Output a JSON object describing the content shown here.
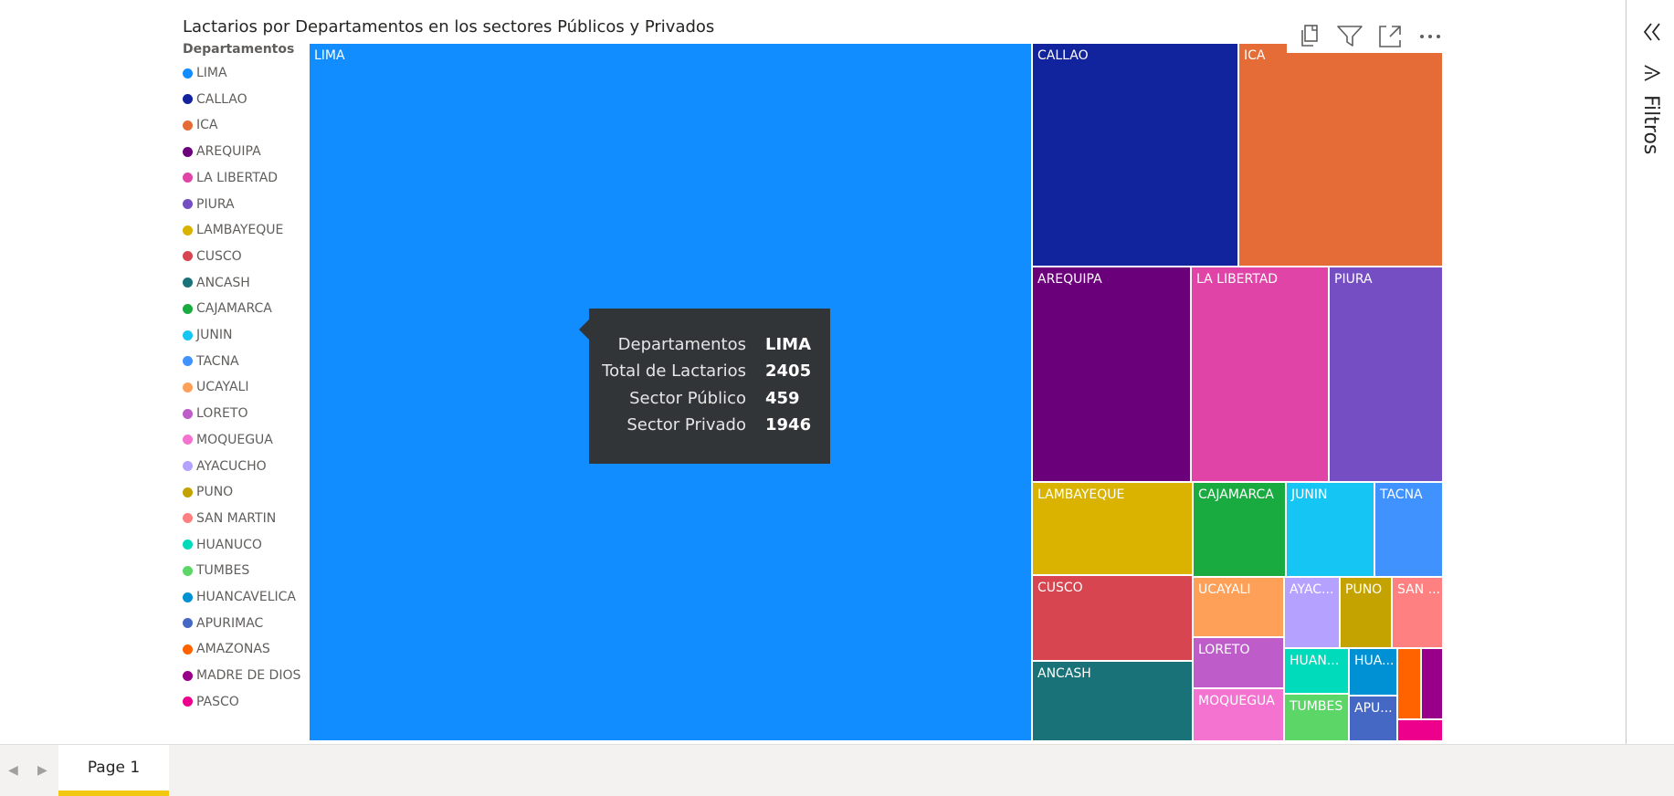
{
  "chart_data": {
    "type": "treemap",
    "title": "Lactarios por Departamentos en los sectores Públicos y Privados",
    "legend_title": "Departamentos",
    "legend_position": "left",
    "legend": [
      {
        "name": "LIMA",
        "color": "#118DFF"
      },
      {
        "name": "CALLAO",
        "color": "#12239E"
      },
      {
        "name": "ICA",
        "color": "#E66C37"
      },
      {
        "name": "AREQUIPA",
        "color": "#6B007B"
      },
      {
        "name": "LA LIBERTAD",
        "color": "#E044A7"
      },
      {
        "name": "PIURA",
        "color": "#744EC2"
      },
      {
        "name": "LAMBAYEQUE",
        "color": "#D9B300"
      },
      {
        "name": "CUSCO",
        "color": "#D64550"
      },
      {
        "name": "ANCASH",
        "color": "#197278"
      },
      {
        "name": "CAJAMARCA",
        "color": "#1AAB40"
      },
      {
        "name": "JUNIN",
        "color": "#15C6F4"
      },
      {
        "name": "TACNA",
        "color": "#4092FF"
      },
      {
        "name": "UCAYALI",
        "color": "#FFA058"
      },
      {
        "name": "LORETO",
        "color": "#BE5DC9"
      },
      {
        "name": "MOQUEGUA",
        "color": "#F472D0"
      },
      {
        "name": "AYACUCHO",
        "color": "#B5A1FF"
      },
      {
        "name": "PUNO",
        "color": "#C4A200"
      },
      {
        "name": "SAN MARTIN",
        "color": "#FF8080"
      },
      {
        "name": "HUANUCO",
        "color": "#00DBBC"
      },
      {
        "name": "TUMBES",
        "color": "#5BD667"
      },
      {
        "name": "HUANCAVELICA",
        "color": "#0091D5"
      },
      {
        "name": "APURIMAC",
        "color": "#4668C5"
      },
      {
        "name": "AMAZONAS",
        "color": "#FF6300"
      },
      {
        "name": "MADRE DE DIOS",
        "color": "#99008A"
      },
      {
        "name": "PASCO",
        "color": "#EC008C"
      }
    ],
    "tiles": [
      {
        "name": "LIMA",
        "label": "LIMA"
      },
      {
        "name": "CALLAO",
        "label": "CALLAO"
      },
      {
        "name": "ICA",
        "label": "ICA"
      },
      {
        "name": "AREQUIPA",
        "label": "AREQUIPA"
      },
      {
        "name": "LA LIBERTAD",
        "label": "LA LIBERTAD"
      },
      {
        "name": "PIURA",
        "label": "PIURA"
      },
      {
        "name": "LAMBAYEQUE",
        "label": "LAMBAYEQUE"
      },
      {
        "name": "CAJAMARCA",
        "label": "CAJAMARCA"
      },
      {
        "name": "JUNIN",
        "label": "JUNIN"
      },
      {
        "name": "TACNA",
        "label": "TACNA"
      },
      {
        "name": "CUSCO",
        "label": "CUSCO"
      },
      {
        "name": "UCAYALI",
        "label": "UCAYALI"
      },
      {
        "name": "AYACUCHO",
        "label": "AYAC..."
      },
      {
        "name": "PUNO",
        "label": "PUNO"
      },
      {
        "name": "SAN MARTIN",
        "label": "SAN ..."
      },
      {
        "name": "LORETO",
        "label": "LORETO"
      },
      {
        "name": "HUANUCO",
        "label": "HUAN..."
      },
      {
        "name": "HUANCAVELICA",
        "label": "HUA..."
      },
      {
        "name": "AMAZONAS",
        "label": ""
      },
      {
        "name": "MADRE DE DIOS",
        "label": ""
      },
      {
        "name": "ANCASH",
        "label": "ANCASH"
      },
      {
        "name": "MOQUEGUA",
        "label": "MOQUEGUA"
      },
      {
        "name": "TUMBES",
        "label": "TUMBES"
      },
      {
        "name": "APURIMAC",
        "label": "APU..."
      },
      {
        "name": "PASCO",
        "label": ""
      }
    ],
    "tooltip": {
      "target": "LIMA",
      "rows": [
        {
          "label": "Departamentos",
          "value": "LIMA"
        },
        {
          "label": "Total de Lactarios",
          "value": "2405"
        },
        {
          "label": "Sector Público",
          "value": "459"
        },
        {
          "label": "Sector Privado",
          "value": "1946"
        }
      ]
    }
  },
  "toolbar": {
    "icons": [
      "copy-icon",
      "filter-icon",
      "focus-mode-icon",
      "more-options-icon"
    ]
  },
  "filters_pane": {
    "label": "Filtros",
    "icons": [
      "collapse-chevrons-icon",
      "filter-icon"
    ]
  },
  "page_tabs": {
    "tabs": [
      {
        "label": "Page 1",
        "active": true
      }
    ],
    "accent_color": "#F2C811"
  }
}
